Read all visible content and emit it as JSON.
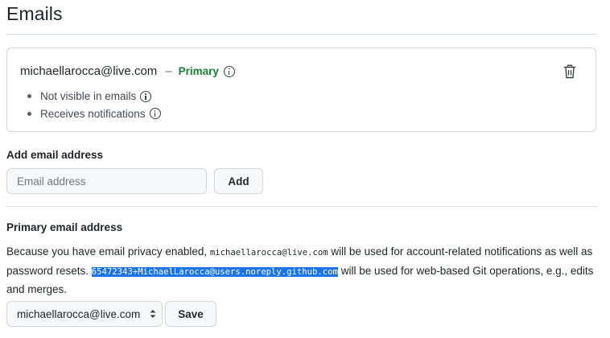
{
  "heading": "Emails",
  "email_card": {
    "address": "michaellarocca@live.com",
    "separator": "–",
    "primary_badge": "Primary",
    "bullets": [
      "Not visible in emails",
      "Receives notifications"
    ]
  },
  "add_email": {
    "label": "Add email address",
    "placeholder": "Email address",
    "button": "Add"
  },
  "primary_email": {
    "label": "Primary email address",
    "text_1": "Because you have email privacy enabled, ",
    "code_1": "michaellarocca@live.com",
    "text_2": " will be used for account-related notifications as well as password resets. ",
    "code_2": "65472343+MichaelLarocca@users.noreply.github.com",
    "text_3": " will be used for web-based Git operations, e.g., edits and merges.",
    "selected": "michaellarocca@live.com",
    "save_button": "Save"
  },
  "colors": {
    "primary_badge": "#1a7f37",
    "text_selection": "#1a73e8",
    "border": "#d0d7de"
  },
  "icons": [
    "info-icon",
    "trash-icon",
    "select-caret-icon"
  ]
}
